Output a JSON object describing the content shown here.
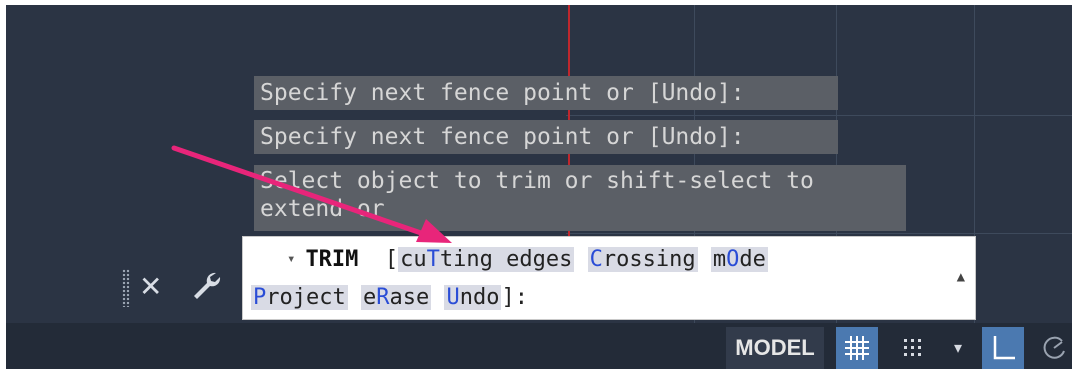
{
  "history": [
    "Specify next fence point or [Undo]:",
    "Specify next fence point or [Undo]:",
    "Select object to trim or shift-select to extend or"
  ],
  "command": {
    "caret": "▾",
    "name": "TRIM",
    "open_bracket": "[",
    "options": [
      {
        "pre": "cu",
        "key": "T",
        "post": "ting edges"
      },
      {
        "pre": "",
        "key": "C",
        "post": "rossing"
      },
      {
        "pre": "m",
        "key": "O",
        "post": "de"
      },
      {
        "pre": "",
        "key": "P",
        "post": "roject"
      },
      {
        "pre": "e",
        "key": "R",
        "post": "ase"
      },
      {
        "pre": "",
        "key": "U",
        "post": "ndo"
      }
    ],
    "close": "]:"
  },
  "toolbar": {
    "close_icon": "close-icon",
    "customize_icon": "wrench-icon"
  },
  "statusbar": {
    "model_label": "MODEL",
    "grid_icon": "grid-icon",
    "snap_icon": "snap-icon",
    "dropdown_icon": "chevron-down-icon",
    "ortho_icon": "ortho-icon",
    "polar_icon": "polar-icon"
  },
  "colors": {
    "canvas": "#2b3444",
    "crosshair": "#c0272d",
    "annotation_arrow": "#e8257a",
    "option_key": "#2a4dd6",
    "active_toggle": "#4b79b0"
  }
}
